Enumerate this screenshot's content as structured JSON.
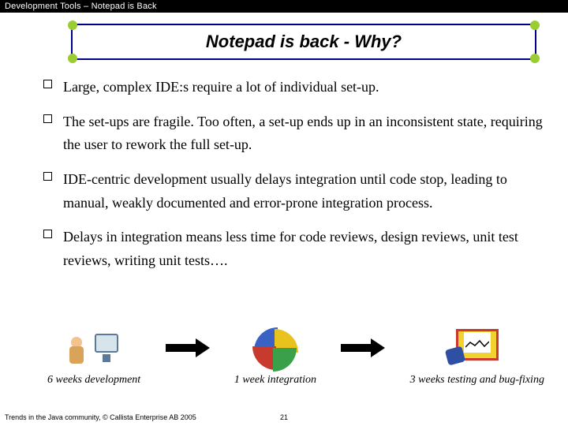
{
  "header": {
    "text": "Development Tools – Notepad is Back"
  },
  "title": "Notepad is back - Why?",
  "bullets": [
    "Large, complex IDE:s require a lot of individual set-up.",
    "The set-ups are fragile. Too often, a set-up ends up in an inconsistent state, requiring the user to rework the full set-up.",
    "IDE-centric development usually delays integration until code stop, leading to manual, weakly documented and error-prone integration process.",
    "Delays in integration means less time for code reviews, design reviews, unit test reviews, writing unit tests…."
  ],
  "stages": {
    "dev": "6 weeks development",
    "int": "1 week integration",
    "test": "3 weeks testing and bug-fixing"
  },
  "footer": {
    "copyright": "Trends in the Java community, © Callista Enterprise AB 2005",
    "page": "21"
  }
}
